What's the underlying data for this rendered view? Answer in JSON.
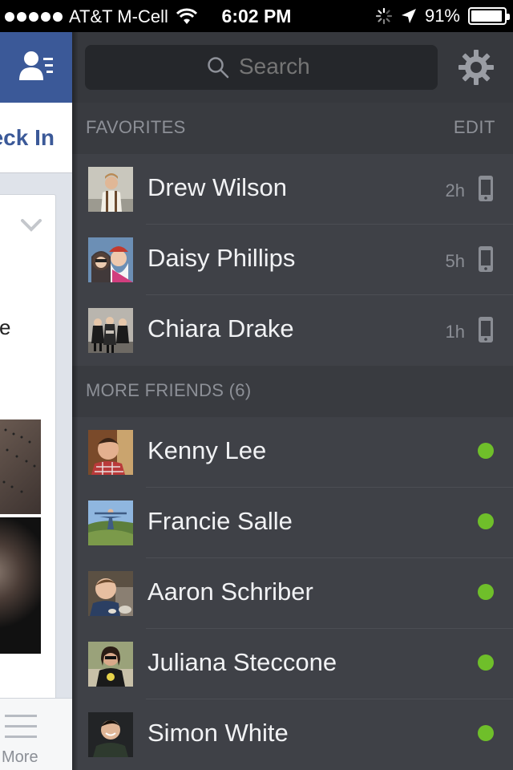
{
  "status_bar": {
    "carrier": "AT&T M-Cell",
    "time": "6:02 PM",
    "battery": "91%"
  },
  "left_app": {
    "checkin_label": "eck In",
    "card_text": "e",
    "more_label": "More"
  },
  "chat_sidebar": {
    "search_placeholder": "Search",
    "favorites": {
      "title": "FAVORITES",
      "edit_label": "EDIT",
      "people": [
        {
          "name": "Drew Wilson",
          "last_active": "2h"
        },
        {
          "name": "Daisy Phillips",
          "last_active": "5h"
        },
        {
          "name": "Chiara Drake",
          "last_active": "1h"
        }
      ]
    },
    "more_friends": {
      "title": "MORE FRIENDS (6)",
      "people": [
        {
          "name": "Kenny Lee"
        },
        {
          "name": "Francie Salle"
        },
        {
          "name": "Aaron Schriber"
        },
        {
          "name": "Juliana Steccone"
        },
        {
          "name": "Simon White"
        }
      ]
    }
  },
  "colors": {
    "facebook_blue": "#3b5998",
    "sidebar_bg": "#3f4147",
    "online_green": "#6fbf2a"
  }
}
